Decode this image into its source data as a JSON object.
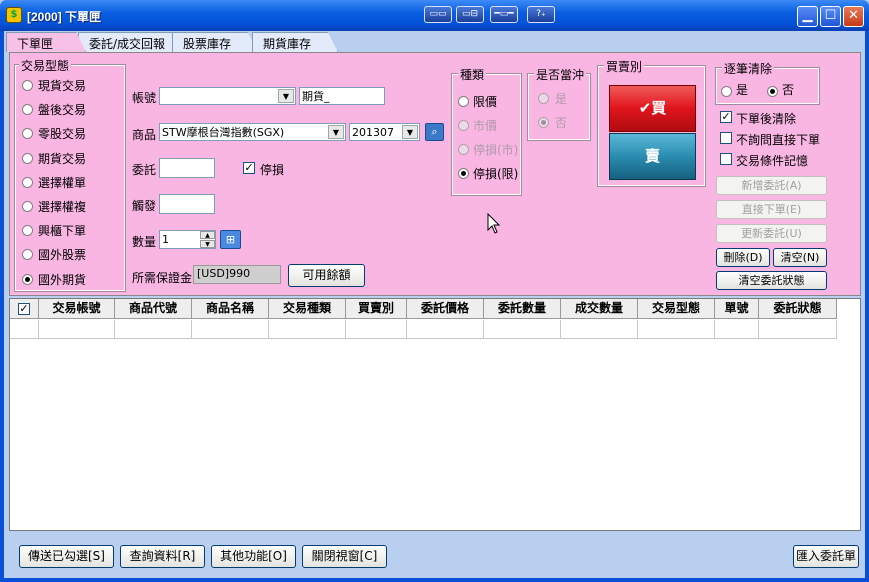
{
  "window": {
    "title": "[2000] 下單匣",
    "toolbar_icons": [
      "window-tile-icon",
      "window-dock-icon",
      "window-strip-icon",
      "help-plus-icon"
    ],
    "toolbar_labels": [
      "▭▭",
      "▭⊟",
      "━▭━",
      "?₊"
    ],
    "app_icon_glyph": "$"
  },
  "tabs": [
    {
      "label": "下單匣",
      "active": true
    },
    {
      "label": "委託/成交回報匣",
      "active": false
    },
    {
      "label": "股票庫存",
      "active": false
    },
    {
      "label": "期貨庫存",
      "active": false
    }
  ],
  "trade_type": {
    "title": "交易型態",
    "options": [
      "現貨交易",
      "盤後交易",
      "零股交易",
      "期貨交易",
      "選擇權單",
      "選擇權複",
      "興櫃下單",
      "國外股票",
      "國外期貨"
    ],
    "selected": "國外期貨"
  },
  "form": {
    "account_label": "帳號",
    "account_value": "",
    "account_type_value": "期貨_",
    "product_label": "商品",
    "product_value": "STW摩根台灣指數(SGX)",
    "month_value": "201307",
    "order_label": "委託",
    "order_value": "",
    "stop_loss_checkbox_label": "停損",
    "stop_loss_checked": true,
    "trigger_label": "觸發",
    "trigger_value": "",
    "quantity_label": "數量",
    "quantity_value": "1",
    "margin_label": "所需保證金",
    "margin_value": "[USD]990",
    "available_balance_button": "可用餘額"
  },
  "price_type": {
    "title": "種類",
    "options": [
      {
        "label": "限價",
        "enabled": true
      },
      {
        "label": "市價",
        "enabled": false
      },
      {
        "label": "停損(市)",
        "enabled": false
      },
      {
        "label": "停損(限)",
        "enabled": true
      }
    ],
    "selected": "停損(限)"
  },
  "day_trade": {
    "title": "是否當沖",
    "options": [
      "是",
      "否"
    ],
    "selected": "否",
    "enabled": false
  },
  "buy_sell": {
    "title": "買賣別",
    "buy_label": "買",
    "sell_label": "賣",
    "buy_color": "#e0141c",
    "sell_color": "#2a8cb0"
  },
  "clear_each": {
    "title": "逐筆清除",
    "options": [
      "是",
      "否"
    ],
    "selected": "否"
  },
  "options_checks": [
    {
      "label": "下單後清除",
      "checked": true
    },
    {
      "label": "不詢問直接下單",
      "checked": false
    },
    {
      "label": "交易條件記憶",
      "checked": false
    }
  ],
  "side_buttons": {
    "add_order": "新增委託(A)",
    "direct_order": "直接下單(E)",
    "update_order": "更新委託(U)",
    "delete": "刪除(D)",
    "clear": "清空(N)",
    "clear_status": "清空委託狀態"
  },
  "table": {
    "columns": [
      "交易帳號",
      "商品代號",
      "商品名稱",
      "交易種類",
      "買賣別",
      "委託價格",
      "委託數量",
      "成交數量",
      "交易型態",
      "單號",
      "委託狀態"
    ],
    "rows": []
  },
  "bottom_buttons": {
    "send_checked": "傳送已勾選[S]",
    "query_data": "查詢資料[R]",
    "other_functions": "其他功能[O]",
    "close_window": "關閉視窗[C]",
    "import_orders": "匯入委託單"
  },
  "colors": {
    "panel_pink": "#f9b6e3",
    "titlebar_blue": "#0a5fe0",
    "frame_blue": "#b9cff0"
  }
}
